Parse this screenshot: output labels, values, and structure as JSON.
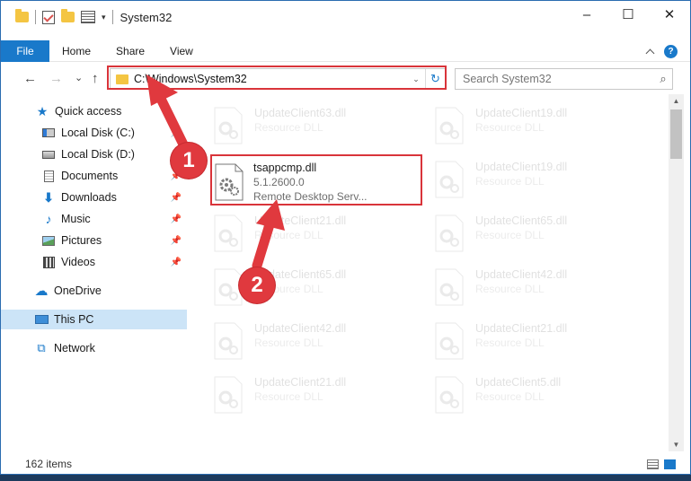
{
  "window": {
    "title": "System32",
    "controls": [
      "–",
      "☐",
      "✕"
    ]
  },
  "quick_access_toolbar": {
    "dropdown": "▾"
  },
  "ribbon": {
    "tabs": [
      "File",
      "Home",
      "Share",
      "View"
    ],
    "help": "?"
  },
  "navigation": {
    "back": "←",
    "forward": "→",
    "recent": "⌄",
    "up": "↑"
  },
  "address_bar": {
    "path": "C:\\Windows\\System32",
    "dropdown": "⌄",
    "refresh": "↻"
  },
  "search": {
    "placeholder": "Search System32",
    "icon": "⌕"
  },
  "sidebar": {
    "items": [
      {
        "label": "Quick access",
        "icon": "star-icon",
        "pinned": false
      },
      {
        "label": "Local Disk (C:)",
        "icon": "drive-icon",
        "pinned": true
      },
      {
        "label": "Local Disk (D:)",
        "icon": "drive-icon",
        "pinned": true
      },
      {
        "label": "Documents",
        "icon": "documents-icon",
        "pinned": true
      },
      {
        "label": "Downloads",
        "icon": "download-icon",
        "pinned": true
      },
      {
        "label": "Music",
        "icon": "music-icon",
        "pinned": true
      },
      {
        "label": "Pictures",
        "icon": "pictures-icon",
        "pinned": true
      },
      {
        "label": "Videos",
        "icon": "videos-icon",
        "pinned": true
      },
      {
        "label": "OneDrive",
        "icon": "cloud-icon",
        "pinned": false
      },
      {
        "label": "This PC",
        "icon": "computer-icon",
        "pinned": false,
        "selected": true
      },
      {
        "label": "Network",
        "icon": "network-icon",
        "pinned": false
      }
    ],
    "pin_glyph": "📌"
  },
  "files": [
    {
      "name": "UpdateClient63.dll",
      "type": "Resource DLL",
      "faded": true
    },
    {
      "name": "UpdateClient19.dll",
      "type": "Resource DLL",
      "faded": true
    },
    {
      "name": "tsappcmp.dll",
      "version": "5.1.2600.0",
      "type": "Remote Desktop Serv...",
      "faded": false,
      "highlighted": true
    },
    {
      "name": "UpdateClient19.dll",
      "type": "Resource DLL",
      "faded": true
    },
    {
      "name": "UpdateClient21.dll",
      "type": "Resource DLL",
      "faded": true
    },
    {
      "name": "UpdateClient65.dll",
      "type": "Resource DLL",
      "faded": true
    },
    {
      "name": "UpdateClient65.dll",
      "type": "Resource DLL",
      "faded": true
    },
    {
      "name": "UpdateClient42.dll",
      "type": "Resource DLL",
      "faded": true
    },
    {
      "name": "UpdateClient42.dll",
      "type": "Resource DLL",
      "faded": true
    },
    {
      "name": "UpdateClient21.dll",
      "type": "Resource DLL",
      "faded": true
    },
    {
      "name": "UpdateClient21.dll",
      "type": "Resource DLL",
      "faded": true
    },
    {
      "name": "UpdateClient5.dll",
      "type": "Resource DLL",
      "faded": true
    }
  ],
  "status": {
    "item_count": "162 items"
  },
  "annotations": {
    "step1": "1",
    "step2": "2",
    "color": "#e0393e"
  }
}
